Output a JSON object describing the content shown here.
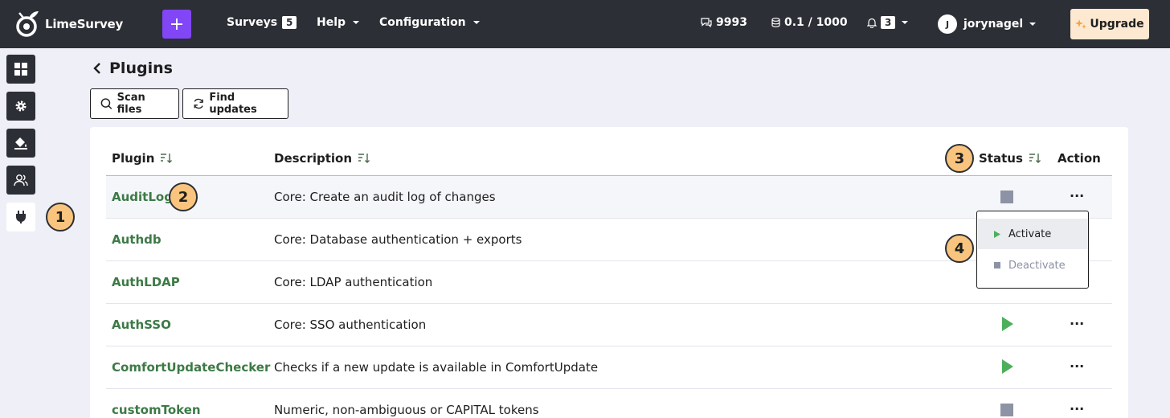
{
  "brand": {
    "name": "LimeSurvey"
  },
  "topnav": {
    "create_label": "+",
    "surveys_label": "Surveys",
    "surveys_count": "5",
    "help_label": "Help",
    "configuration_label": "Configuration",
    "responses_value": "9993",
    "storage_value": "0.1 / 1000",
    "notifications_count": "3",
    "user_initial": "J",
    "username": "jorynagel",
    "upgrade_label": "Upgrade"
  },
  "page": {
    "title": "Plugins",
    "scan_files_label": "Scan files",
    "find_updates_label": "Find updates"
  },
  "table": {
    "columns": {
      "plugin": "Plugin",
      "description": "Description",
      "status": "Status",
      "action": "Action"
    },
    "rows": [
      {
        "name": "AuditLog",
        "description": "Core: Create an audit log of changes",
        "status": "inactive"
      },
      {
        "name": "Authdb",
        "description": "Core: Database authentication + exports",
        "status": "active"
      },
      {
        "name": "AuthLDAP",
        "description": "Core: LDAP authentication",
        "status": "active"
      },
      {
        "name": "AuthSSO",
        "description": "Core: SSO authentication",
        "status": "active"
      },
      {
        "name": "ComfortUpdateChecker",
        "description": "Checks if a new update is available in ComfortUpdate",
        "status": "active"
      },
      {
        "name": "customToken",
        "description": "Numeric, non-ambiguous or CAPITAL tokens",
        "status": "inactive"
      }
    ],
    "action_glyph": "···"
  },
  "dropdown": {
    "activate_label": "Activate",
    "deactivate_label": "Deactivate"
  },
  "callouts": [
    "1",
    "2",
    "3",
    "4"
  ],
  "colors": {
    "topbar": "#2d2f36",
    "accent": "#8146f6",
    "plugin_link": "#3c7a46",
    "play": "#4caf5c",
    "stop": "#8d92a5",
    "badge": "#f9c57e",
    "upgrade": "#fde9d2"
  }
}
